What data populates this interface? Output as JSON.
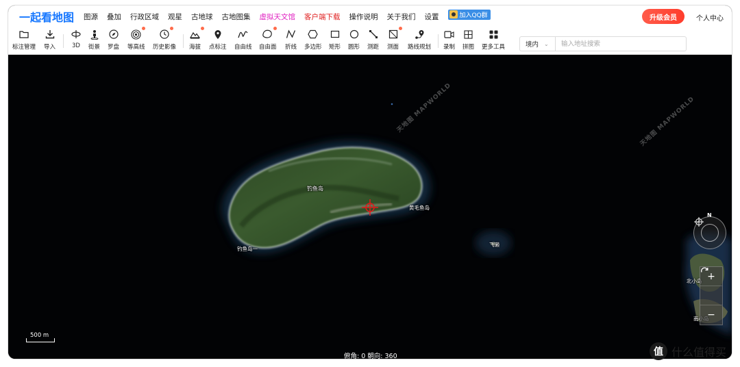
{
  "topnav": {
    "logo": "一起看地图",
    "items": [
      "图源",
      "叠加",
      "行政区域",
      "观星",
      "古地球",
      "古地图集"
    ],
    "virtual_observatory": "虚拟天文馆",
    "client_download": "客户端下载",
    "items2": [
      "操作说明",
      "关于我们",
      "设置"
    ],
    "qq_group": "加入QQ群",
    "upgrade": "升级会员",
    "user_center": "个人中心"
  },
  "toolbar": {
    "tools": [
      {
        "label": "标注管理",
        "icon": "folder-icon"
      },
      {
        "label": "导入",
        "icon": "download-icon"
      },
      {
        "label": "3D",
        "icon": "rotate-3d-icon"
      },
      {
        "label": "街景",
        "icon": "pegman-icon"
      },
      {
        "label": "罗盘",
        "icon": "compass-icon"
      },
      {
        "label": "等高线",
        "icon": "contour-icon"
      },
      {
        "label": "历史影像",
        "icon": "clock-icon"
      },
      {
        "label": "海拔",
        "icon": "mountain-icon"
      },
      {
        "label": "点标注",
        "icon": "pin-icon"
      },
      {
        "label": "自由线",
        "icon": "freehand-line-icon"
      },
      {
        "label": "自由面",
        "icon": "freehand-area-icon"
      },
      {
        "label": "折线",
        "icon": "polyline-icon"
      },
      {
        "label": "多边形",
        "icon": "polygon-icon"
      },
      {
        "label": "矩形",
        "icon": "rectangle-icon"
      },
      {
        "label": "圆形",
        "icon": "circle-icon"
      },
      {
        "label": "测距",
        "icon": "measure-distance-icon"
      },
      {
        "label": "测面",
        "icon": "measure-area-icon"
      },
      {
        "label": "路线规划",
        "icon": "route-icon"
      },
      {
        "label": "录制",
        "icon": "record-icon"
      },
      {
        "label": "拼图",
        "icon": "grid-icon"
      },
      {
        "label": "更多工具",
        "icon": "apps-icon"
      }
    ],
    "region": "境内",
    "search_placeholder": "输入地址搜索"
  },
  "map": {
    "labels": {
      "main_island": "钓鱼岛",
      "east_tip": "黄毛鱼岛",
      "southwest_tip": "钓鱼岛一",
      "islet": "飞濑",
      "right_edge_1": "北小岛",
      "right_edge_2": "南小岛"
    },
    "watermark": "天地图 MAPWORLD",
    "compass_north": "N",
    "scale_label": "500 m",
    "status": "俯角: 0 朝向: 360"
  },
  "brand": {
    "mark": "值",
    "text": "什么值得买"
  }
}
